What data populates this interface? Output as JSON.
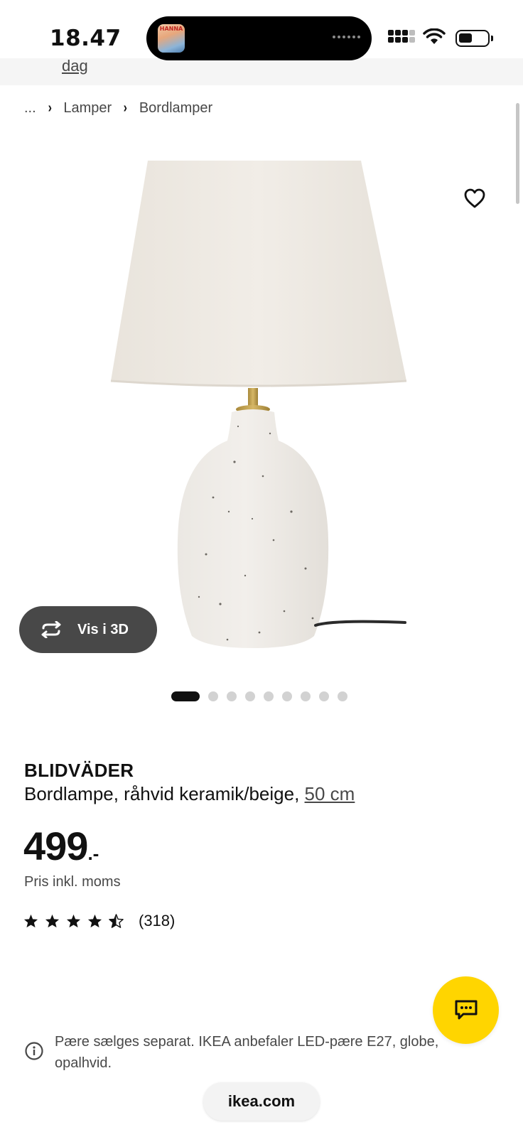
{
  "status_bar": {
    "time": "18.47",
    "island_thumb_text": "HANNA"
  },
  "top_band": {
    "link_text": "dag"
  },
  "breadcrumb": {
    "items": [
      "...",
      "Lamper",
      "Bordlamper"
    ]
  },
  "gallery": {
    "button_label": "Vis i 3D",
    "image_count": 9,
    "active_index": 0
  },
  "product": {
    "name": "BLIDVÄDER",
    "description": "Bordlampe, råhvid keramik/beige, ",
    "size_link": "50 cm",
    "price_integer": "499",
    "price_suffix": ".-",
    "vat_note": "Pris inkl. moms",
    "rating_stars": 4.5,
    "review_count": "(318)"
  },
  "notice": {
    "text": "Pære sælges separat. IKEA anbefaler LED-pære E27, globe, opalhvid."
  },
  "browser": {
    "url": "ikea.com"
  },
  "colors": {
    "accent_yellow": "#ffd500",
    "dark_button": "#484848",
    "text_secondary": "#484848"
  }
}
